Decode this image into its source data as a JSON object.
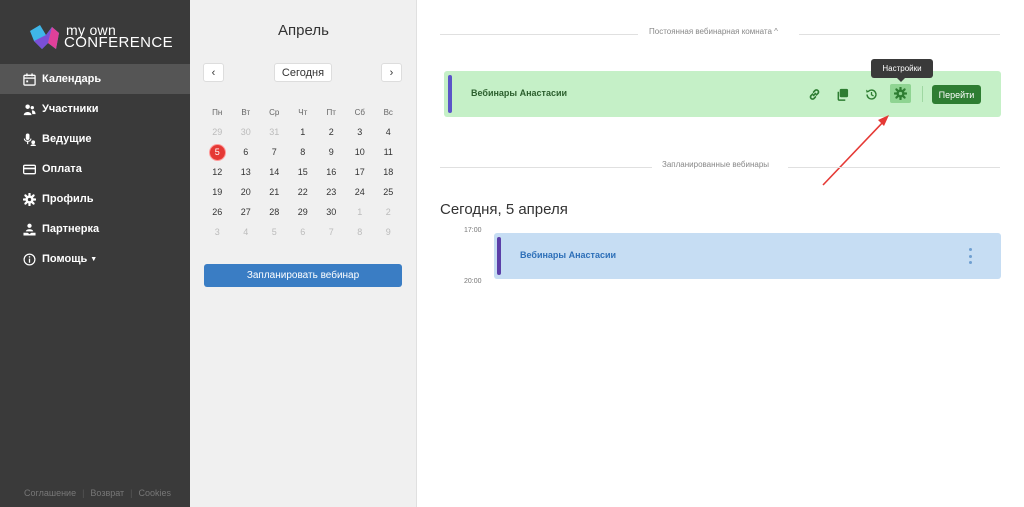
{
  "brand": {
    "line1": "my own",
    "line2": "CONFERENCE"
  },
  "sidebar": {
    "items": [
      {
        "label": "Календарь",
        "icon": "calendar-icon",
        "active": true
      },
      {
        "label": "Участники",
        "icon": "participants-icon"
      },
      {
        "label": "Ведущие",
        "icon": "presenters-icon"
      },
      {
        "label": "Оплата",
        "icon": "card-icon"
      },
      {
        "label": "Профиль",
        "icon": "gear-icon"
      },
      {
        "label": "Партнерка",
        "icon": "partner-icon"
      },
      {
        "label": "Помощь",
        "icon": "info-icon",
        "has_caret": true
      }
    ],
    "footer": [
      "Соглашение",
      "Возврат",
      "Cookies"
    ]
  },
  "calendar": {
    "month": "Апрель",
    "today_label": "Сегодня",
    "prev": "‹",
    "next": "›",
    "weekdays": [
      "Пн",
      "Вт",
      "Ср",
      "Чт",
      "Пт",
      "Сб",
      "Вс"
    ],
    "weeks": [
      [
        "29",
        "30",
        "31",
        "1",
        "2",
        "3",
        "4"
      ],
      [
        "5",
        "6",
        "7",
        "8",
        "9",
        "10",
        "11"
      ],
      [
        "12",
        "13",
        "14",
        "15",
        "16",
        "17",
        "18"
      ],
      [
        "19",
        "20",
        "21",
        "22",
        "23",
        "24",
        "25"
      ],
      [
        "26",
        "27",
        "28",
        "29",
        "30",
        "1",
        "2"
      ],
      [
        "3",
        "4",
        "5",
        "6",
        "7",
        "8",
        "9"
      ]
    ],
    "muted": [
      [
        0,
        0
      ],
      [
        0,
        1
      ],
      [
        0,
        2
      ],
      [
        4,
        5
      ],
      [
        4,
        6
      ],
      [
        5,
        0
      ],
      [
        5,
        1
      ],
      [
        5,
        2
      ],
      [
        5,
        3
      ],
      [
        5,
        4
      ],
      [
        5,
        5
      ],
      [
        5,
        6
      ]
    ],
    "selected": [
      1,
      0
    ],
    "plan_button": "Запланировать вебинар"
  },
  "main": {
    "permanent_section": "Постоянная вебинарная комната ^",
    "permanent_room": {
      "title": "Вебинары Анастасии",
      "actions": [
        "link-icon",
        "copy-icon",
        "history-icon",
        "gear-icon"
      ],
      "tooltip": "Настройки",
      "go_label": "Перейти"
    },
    "scheduled_section": "Запланированные вебинары",
    "today_heading": "Сегодня, 5 апреля",
    "times": [
      "17:00",
      "20:00"
    ],
    "scheduled_item": {
      "title": "Вебинары Анастасии"
    }
  },
  "colors": {
    "sidebar_bg": "#3a3a3a",
    "accent_blue": "#3a7dc4",
    "room_green": "#c5f0c7",
    "go_green": "#2e7d32",
    "today_red": "#e53935",
    "arrow_red": "#e53935"
  }
}
